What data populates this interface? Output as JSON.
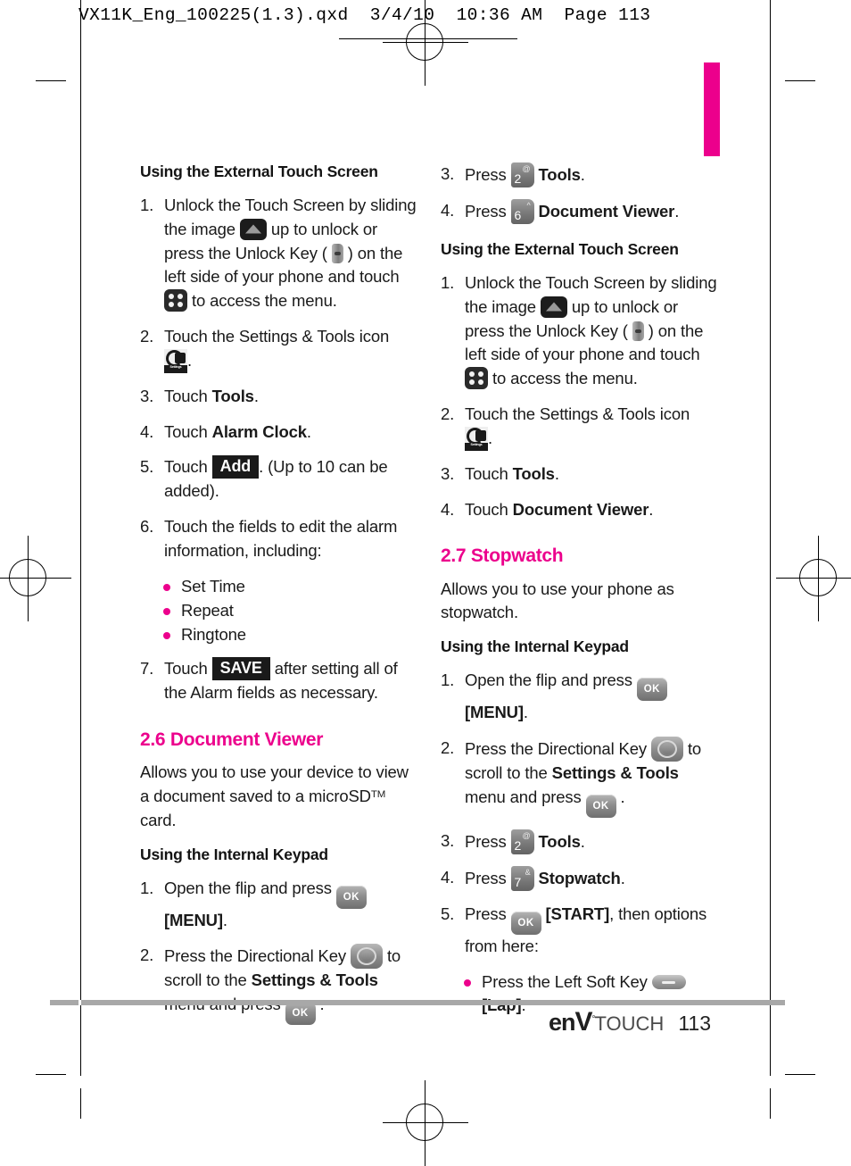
{
  "print_header": "VX11K_Eng_100225(1.3).qxd  3/4/10  10:36 AM  Page 113",
  "accent_color": "#EC008C",
  "footer": {
    "logo_en": "en",
    "logo_v": "V",
    "logo_reg": "°",
    "logo_touch": "TOUCH",
    "page_number": "113"
  },
  "left_column": {
    "heading_external": "Using the External Touch Screen",
    "alarm_steps": [
      {
        "num": "1.",
        "parts": [
          {
            "t": "text",
            "v": "Unlock the Touch Screen by sliding the image "
          },
          {
            "t": "icon",
            "v": "unlock-slider-icon"
          },
          {
            "t": "text",
            "v": " up to unlock or press the Unlock Key ( "
          },
          {
            "t": "icon",
            "v": "unlock-key-icon"
          },
          {
            "t": "text",
            "v": " ) on the left side of your phone and touch "
          },
          {
            "t": "icon",
            "v": "menu-dots-icon"
          },
          {
            "t": "text",
            "v": " to access the menu."
          }
        ]
      },
      {
        "num": "2.",
        "parts": [
          {
            "t": "text",
            "v": "Touch the Settings & Tools icon "
          },
          {
            "t": "icon",
            "v": "settings-tools-icon"
          },
          {
            "t": "text",
            "v": "."
          }
        ]
      },
      {
        "num": "3.",
        "parts": [
          {
            "t": "text",
            "v": "Touch "
          },
          {
            "t": "bold",
            "v": "Tools"
          },
          {
            "t": "text",
            "v": "."
          }
        ]
      },
      {
        "num": "4.",
        "parts": [
          {
            "t": "text",
            "v": "Touch "
          },
          {
            "t": "bold",
            "v": "Alarm Clock"
          },
          {
            "t": "text",
            "v": "."
          }
        ]
      },
      {
        "num": "5.",
        "parts": [
          {
            "t": "text",
            "v": "Touch "
          },
          {
            "t": "chip",
            "v": "Add"
          },
          {
            "t": "text",
            "v": ". (Up to 10 can be added)."
          }
        ]
      },
      {
        "num": "6.",
        "parts": [
          {
            "t": "text",
            "v": "Touch the fields to edit the alarm information, including:"
          }
        ]
      }
    ],
    "alarm_bullets": [
      "Set Time",
      "Repeat",
      "Ringtone"
    ],
    "alarm_step7": {
      "num": "7.",
      "parts": [
        {
          "t": "text",
          "v": "Touch "
        },
        {
          "t": "chip",
          "v": "SAVE"
        },
        {
          "t": "text",
          "v": " after setting all of the Alarm fields as necessary."
        }
      ]
    },
    "section_heading": "2.6 Document Viewer",
    "section_intro_a": "Allows you to use your device to view a document saved to a microSD",
    "section_intro_tm": "TM",
    "section_intro_b": " card.",
    "heading_internal": "Using the Internal Keypad",
    "internal_steps": [
      {
        "num": "1.",
        "parts": [
          {
            "t": "text",
            "v": "Open the flip and press "
          },
          {
            "t": "icon",
            "v": "ok-key-icon"
          },
          {
            "t": "bold",
            "v": " [MENU]"
          },
          {
            "t": "text",
            "v": "."
          }
        ]
      },
      {
        "num": "2.",
        "parts": [
          {
            "t": "text",
            "v": "Press the Directional Key "
          },
          {
            "t": "icon",
            "v": "directional-key-icon"
          },
          {
            "t": "text",
            "v": " to scroll to the "
          },
          {
            "t": "bold",
            "v": "Settings & Tools"
          },
          {
            "t": "text",
            "v": " menu and press "
          },
          {
            "t": "icon",
            "v": "ok-key-icon"
          },
          {
            "t": "text",
            "v": " ."
          }
        ]
      }
    ]
  },
  "right_column": {
    "internal_steps_cont": [
      {
        "num": "3.",
        "parts": [
          {
            "t": "text",
            "v": "Press "
          },
          {
            "t": "numkey",
            "v": "2",
            "sup": "@"
          },
          {
            "t": "bold",
            "v": " Tools"
          },
          {
            "t": "text",
            "v": "."
          }
        ]
      },
      {
        "num": "4.",
        "parts": [
          {
            "t": "text",
            "v": "Press "
          },
          {
            "t": "numkey",
            "v": "6",
            "sup": "^"
          },
          {
            "t": "bold",
            "v": " Document Viewer"
          },
          {
            "t": "text",
            "v": "."
          }
        ]
      }
    ],
    "heading_external": "Using the External Touch Screen",
    "external_steps": [
      {
        "num": "1.",
        "parts": [
          {
            "t": "text",
            "v": "Unlock the Touch Screen by sliding the image "
          },
          {
            "t": "icon",
            "v": "unlock-slider-icon"
          },
          {
            "t": "text",
            "v": " up to unlock or press the Unlock Key ( "
          },
          {
            "t": "icon",
            "v": "unlock-key-icon"
          },
          {
            "t": "text",
            "v": " ) on the left side of your phone and touch "
          },
          {
            "t": "icon",
            "v": "menu-dots-icon"
          },
          {
            "t": "text",
            "v": " to access the menu."
          }
        ]
      },
      {
        "num": "2.",
        "parts": [
          {
            "t": "text",
            "v": "Touch the Settings & Tools icon "
          },
          {
            "t": "icon",
            "v": "settings-tools-icon"
          },
          {
            "t": "text",
            "v": "."
          }
        ]
      },
      {
        "num": "3.",
        "parts": [
          {
            "t": "text",
            "v": "Touch "
          },
          {
            "t": "bold",
            "v": "Tools"
          },
          {
            "t": "text",
            "v": "."
          }
        ]
      },
      {
        "num": "4.",
        "parts": [
          {
            "t": "text",
            "v": "Touch "
          },
          {
            "t": "bold",
            "v": "Document Viewer"
          },
          {
            "t": "text",
            "v": "."
          }
        ]
      }
    ],
    "section_heading": "2.7 Stopwatch",
    "section_intro": "Allows you to use your phone as stopwatch.",
    "heading_internal": "Using the Internal Keypad",
    "stopwatch_steps": [
      {
        "num": "1.",
        "parts": [
          {
            "t": "text",
            "v": "Open the flip and press "
          },
          {
            "t": "icon",
            "v": "ok-key-icon"
          },
          {
            "t": "bold",
            "v": " [MENU]"
          },
          {
            "t": "text",
            "v": "."
          }
        ]
      },
      {
        "num": "2.",
        "parts": [
          {
            "t": "text",
            "v": "Press the Directional Key "
          },
          {
            "t": "icon",
            "v": "directional-key-icon"
          },
          {
            "t": "text",
            "v": " to scroll to the "
          },
          {
            "t": "bold",
            "v": "Settings & Tools"
          },
          {
            "t": "text",
            "v": " menu and press "
          },
          {
            "t": "icon",
            "v": "ok-key-icon"
          },
          {
            "t": "text",
            "v": " ."
          }
        ]
      },
      {
        "num": "3.",
        "parts": [
          {
            "t": "text",
            "v": "Press "
          },
          {
            "t": "numkey",
            "v": "2",
            "sup": "@"
          },
          {
            "t": "bold",
            "v": " Tools"
          },
          {
            "t": "text",
            "v": "."
          }
        ]
      },
      {
        "num": "4.",
        "parts": [
          {
            "t": "text",
            "v": "Press "
          },
          {
            "t": "numkey",
            "v": "7",
            "sup": "&"
          },
          {
            "t": "bold",
            "v": " Stopwatch"
          },
          {
            "t": "text",
            "v": "."
          }
        ]
      },
      {
        "num": "5.",
        "parts": [
          {
            "t": "text",
            "v": "Press "
          },
          {
            "t": "icon",
            "v": "ok-key-icon"
          },
          {
            "t": "bold",
            "v": " [START]"
          },
          {
            "t": "text",
            "v": ", then options from here:"
          }
        ]
      }
    ],
    "stopwatch_bullets": [
      {
        "parts": [
          {
            "t": "text",
            "v": "Press the Left Soft Key "
          },
          {
            "t": "icon",
            "v": "left-soft-key-icon"
          },
          {
            "t": "bold",
            "v": " [Lap]"
          },
          {
            "t": "text",
            "v": "."
          }
        ]
      }
    ]
  }
}
